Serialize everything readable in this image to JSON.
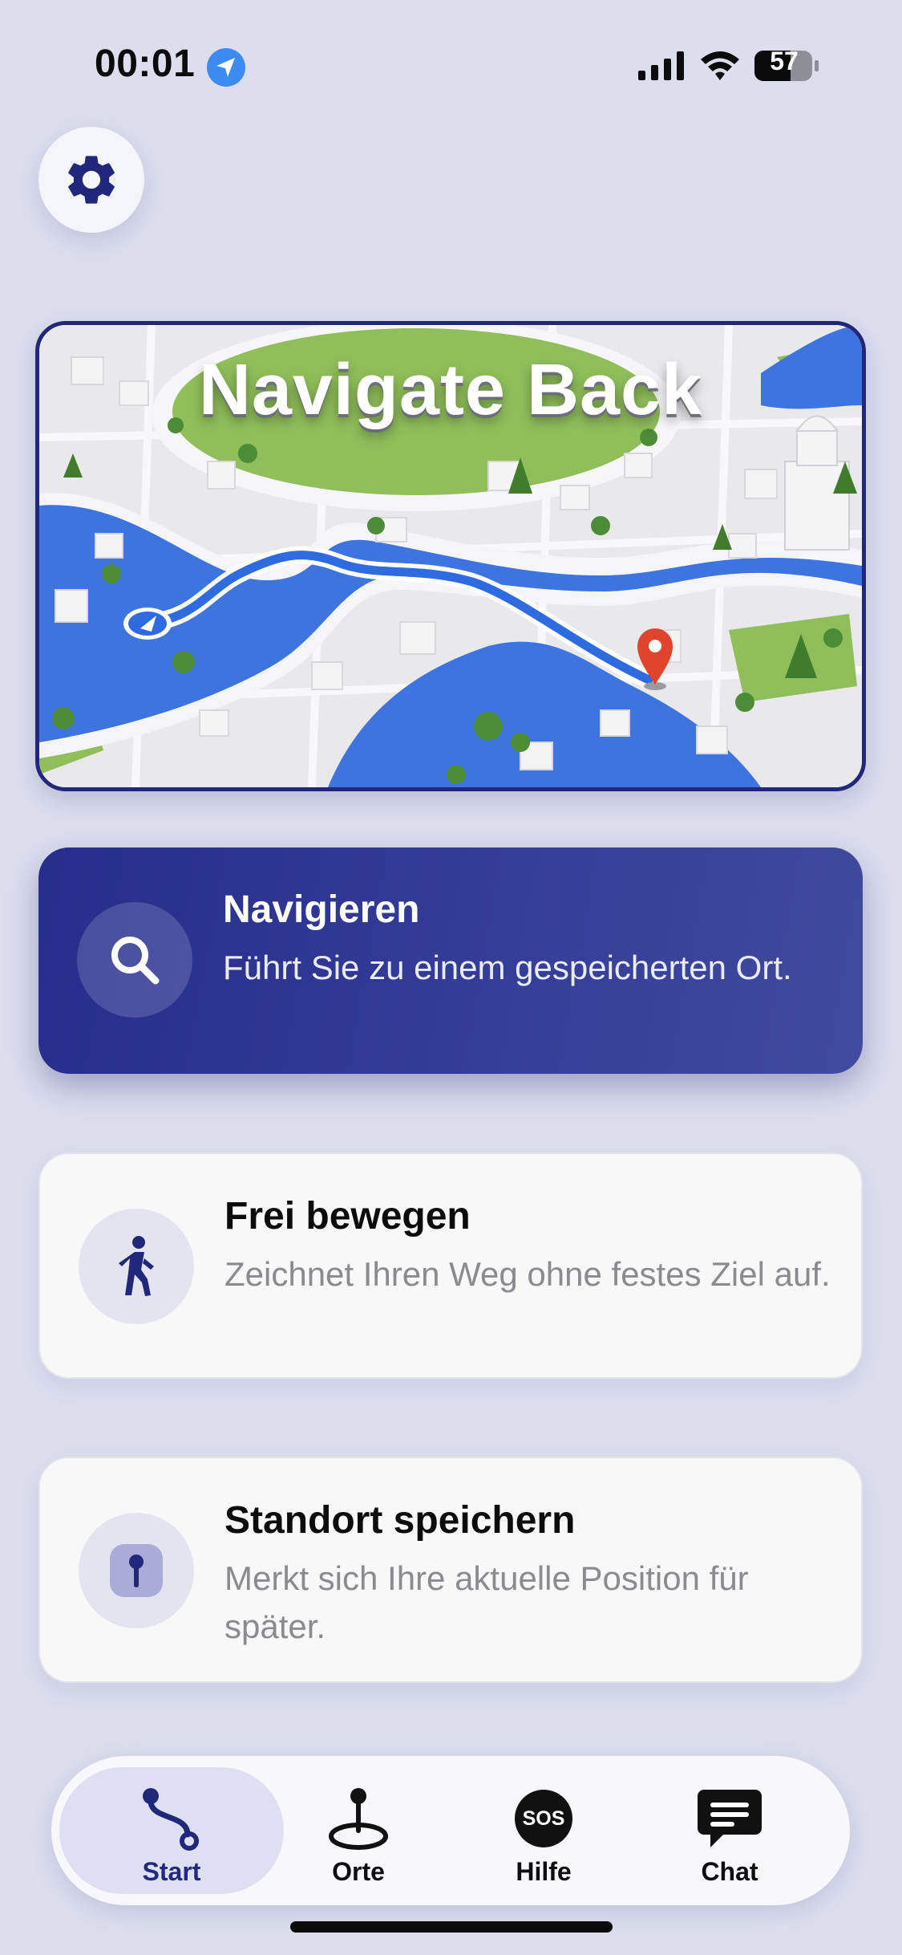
{
  "status_bar": {
    "time": "00:01",
    "battery_level": "57",
    "icons": [
      "location-arrow-icon",
      "cellular-signal-icon",
      "wifi-icon",
      "battery-icon"
    ]
  },
  "settings": {
    "icon": "gear-icon"
  },
  "hero": {
    "title": "Navigate Back",
    "image": "city-map-illustration"
  },
  "cards": [
    {
      "title": "Navigieren",
      "description": "Führt Sie zu einem gespeicherten Ort.",
      "icon": "search-icon"
    },
    {
      "title": "Frei bewegen",
      "description": "Zeichnet Ihren Weg ohne festes Ziel auf.",
      "icon": "walking-person-icon"
    },
    {
      "title": "Standort speichern",
      "description": "Merkt sich Ihre aktuelle Position für später.",
      "icon": "pin-icon"
    }
  ],
  "tabs": [
    {
      "label": "Start",
      "icon": "route-icon",
      "active": true
    },
    {
      "label": "Orte",
      "icon": "map-pin-icon",
      "active": false
    },
    {
      "label": "Hilfe",
      "icon": "sos-icon",
      "icon_text": "SOS",
      "active": false
    },
    {
      "label": "Chat",
      "icon": "chat-icon",
      "active": false
    }
  ],
  "colors": {
    "background": "#dcdeee",
    "accent": "#262d8c",
    "river": "#3d74e0",
    "park": "#8fbe5a",
    "pin": "#e0442a"
  }
}
